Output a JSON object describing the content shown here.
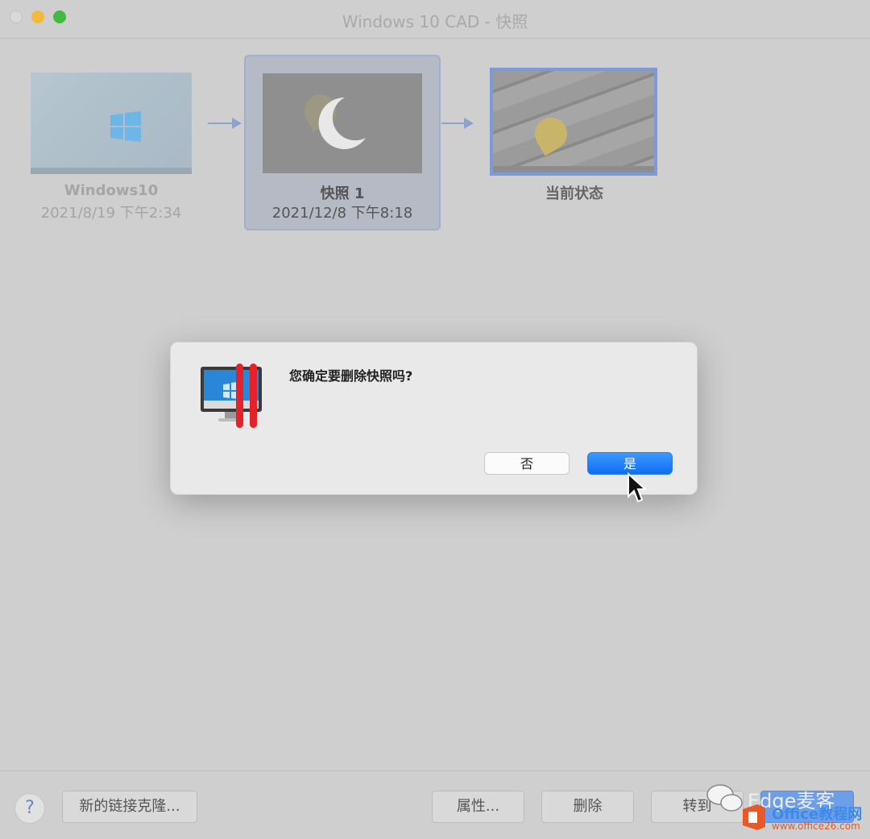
{
  "window": {
    "title": "Windows 10 CAD - 快照"
  },
  "snapshots": [
    {
      "name": "Windows10",
      "date": "2021/8/19 下午2:34"
    },
    {
      "name": "快照 1",
      "date": "2021/12/8 下午8:18"
    },
    {
      "name": "当前状态"
    }
  ],
  "dialog": {
    "message": "您确定要删除快照吗?",
    "no_label": "否",
    "yes_label": "是"
  },
  "bottombar": {
    "help_label": "?",
    "clone_label": "新的链接克隆...",
    "properties_label": "属性...",
    "delete_label": "删除",
    "goto_label": "转到",
    "close_label": ""
  },
  "watermark": {
    "text": "Edge麦客",
    "brand": "Office教程网",
    "url": "www.office26.com"
  },
  "colors": {
    "accent": "#0d6ef2",
    "selection": "#9fb0d0"
  }
}
